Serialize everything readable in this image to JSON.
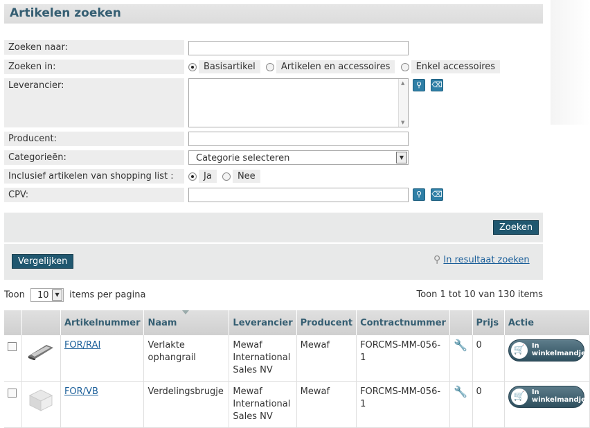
{
  "page_title": "Artikelen zoeken",
  "form": {
    "search_for_label": "Zoeken naar:",
    "search_for_value": "",
    "search_in_label": "Zoeken in:",
    "search_in_options": [
      "Basisartikel",
      "Artikelen en accessoires",
      "Enkel accessoires"
    ],
    "search_in_selected": "Basisartikel",
    "supplier_label": "Leverancier:",
    "producer_label": "Producent:",
    "producer_value": "",
    "categories_label": "Categorieën:",
    "categories_selected": "Categorie selecteren",
    "shopping_list_label": "Inclusief artikelen van shopping list :",
    "shopping_list_options": [
      "Ja",
      "Nee"
    ],
    "shopping_list_selected": "Ja",
    "cpv_label": "CPV:",
    "cpv_value": ""
  },
  "actions": {
    "search_button": "Zoeken",
    "compare_button": "Vergelijken",
    "search_in_results": "In resultaat zoeken"
  },
  "paging": {
    "show_label": "Toon",
    "per_page": "10",
    "per_page_suffix": "items per pagina",
    "summary": "Toon 1 tot 10 van 130 items"
  },
  "table": {
    "columns": [
      "",
      "",
      "Artikelnummer",
      "Naam",
      "Leverancier",
      "Producent",
      "Contractnummer",
      "",
      "Prijs",
      "Actie"
    ],
    "rows": [
      {
        "article_number": "FOR/RAI",
        "name": "Verlakte ophangrail",
        "supplier": "Mewaf International Sales NV",
        "producer": "Mewaf",
        "contract": "FORCMS-MM-056-1",
        "price": "0",
        "action": "In winkelmandje"
      },
      {
        "article_number": "FOR/VB",
        "name": "Verdelingsbrugje",
        "supplier": "Mewaf International Sales NV",
        "producer": "Mewaf",
        "contract": "FORCMS-MM-056-1",
        "price": "0",
        "action": "In winkelmandje"
      }
    ]
  },
  "icons": {
    "lookup": "magnifier-icon",
    "clear": "trash-icon",
    "contract": "wrench-icon",
    "cart": "cart-icon"
  },
  "colors": {
    "title": "#355e72",
    "button": "#20576f",
    "link": "#1a5e99",
    "panel": "#e8e9e9"
  }
}
